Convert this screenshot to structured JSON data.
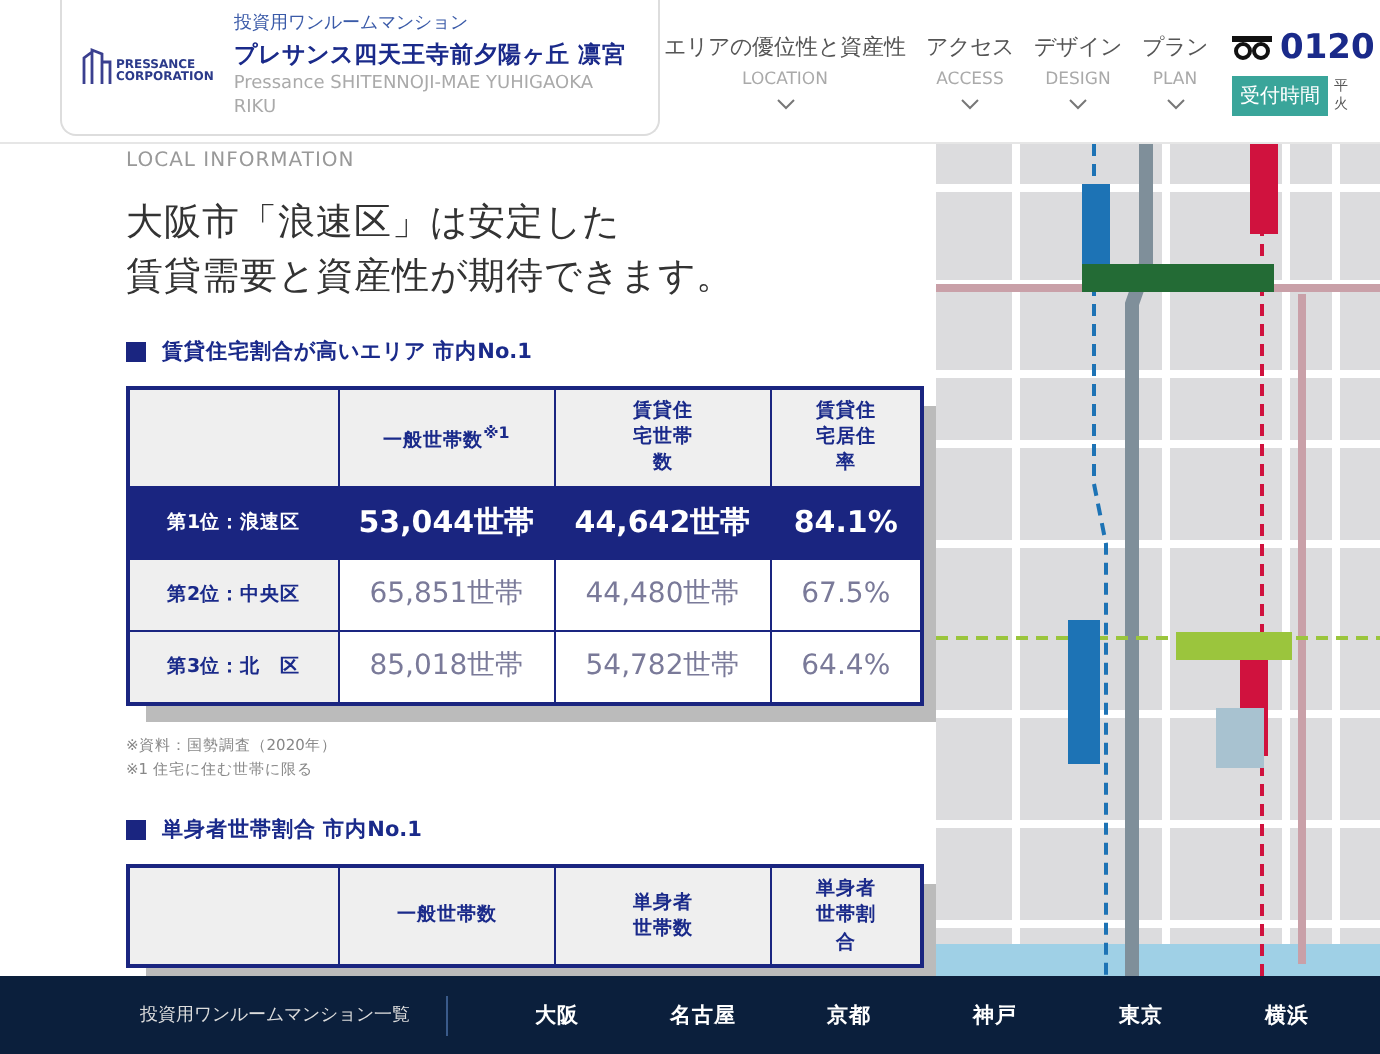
{
  "header": {
    "logo_lines": [
      "PRESSANCE",
      "CORPORATION"
    ],
    "tagline": "投資用ワンルームマンション",
    "name": "プレサンス四天王寺前夕陽ヶ丘 凛宮",
    "name_en": "Pressance SHITENNOJI-MAE YUHIGAOKA RIKU",
    "nav": [
      {
        "label": "エリアの優位性と資産性",
        "sub": "LOCATION"
      },
      {
        "label": "アクセス",
        "sub": "ACCESS"
      },
      {
        "label": "デザイン",
        "sub": "DESIGN"
      },
      {
        "label": "プラン",
        "sub": "PLAN"
      }
    ],
    "phone": "0120",
    "hours_button": "受付時間",
    "hours_text": [
      "平",
      "火"
    ]
  },
  "section_label": "LOCAL INFORMATION",
  "heading": [
    "大阪市「浪速区」は安定した",
    "賃貸需要と資産性が期待できます。"
  ],
  "tables": [
    {
      "title": "賃貸住宅割合が高いエリア 市内No.1",
      "columns": [
        "一般世帯数$^{※1}$",
        "賃貸住宅世帯数",
        "賃貸住宅居住率"
      ],
      "rows": [
        {
          "label": "第1位：浪速区",
          "highlighted": true,
          "cells": [
            "53,044世帯",
            "44,642世帯",
            "84.1%"
          ]
        },
        {
          "label": "第2位：中央区",
          "highlighted": false,
          "cells": [
            "65,851世帯",
            "44,480世帯",
            "67.5%"
          ]
        },
        {
          "label": "第3位：北　区",
          "highlighted": false,
          "cells": [
            "85,018世帯",
            "54,782世帯",
            "64.4%"
          ]
        }
      ],
      "notes": [
        "※資料：国勢調査（2020年）",
        "※1 住宅に住む世帯に限る"
      ]
    },
    {
      "title": "単身者世帯割合 市内No.1",
      "columns": [
        "一般世帯数",
        "単身者世帯数",
        "単身者世帯割合"
      ]
    }
  ],
  "footer": {
    "title": "投資用ワンルームマンション一覧",
    "cities": [
      "大阪",
      "名古屋",
      "京都",
      "神戸",
      "東京",
      "横浜"
    ]
  }
}
